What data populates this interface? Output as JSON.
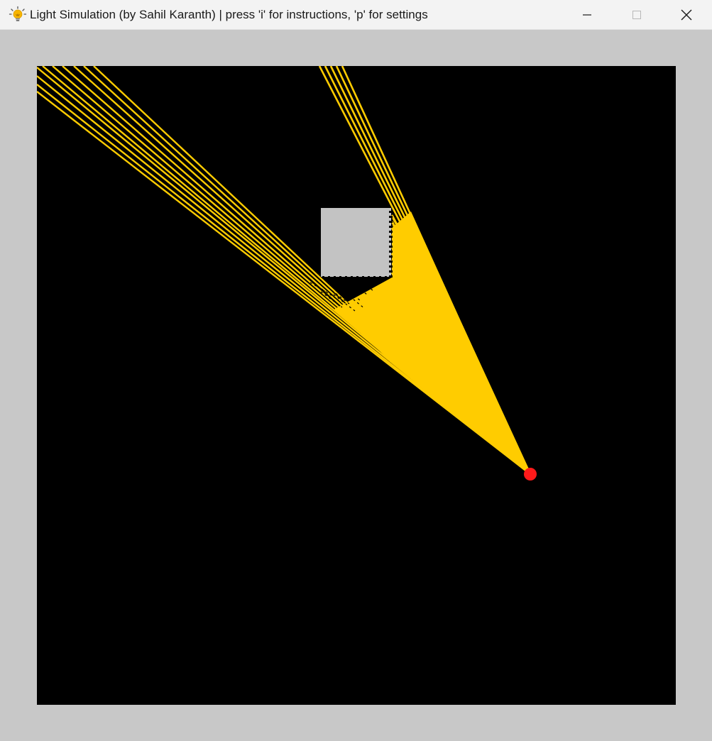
{
  "window": {
    "title": "Light Simulation (by Sahil Karanth) | press 'i' for instructions, 'p' for settings",
    "app_icon": "lightbulb-icon",
    "controls": {
      "minimize_icon": "minimize-icon",
      "maximize_icon": "maximize-icon",
      "close_icon": "close-icon"
    }
  },
  "simulation": {
    "background_color": "#000000",
    "frame_color": "#c8c8c8",
    "ray_color": "#ffcc00",
    "obstacle_color": "#c3c3c3",
    "light_source_color": "#ff0000"
  },
  "colors": {
    "titlebar_bg": "#f3f3f3",
    "title_text": "#1a1a1a"
  }
}
